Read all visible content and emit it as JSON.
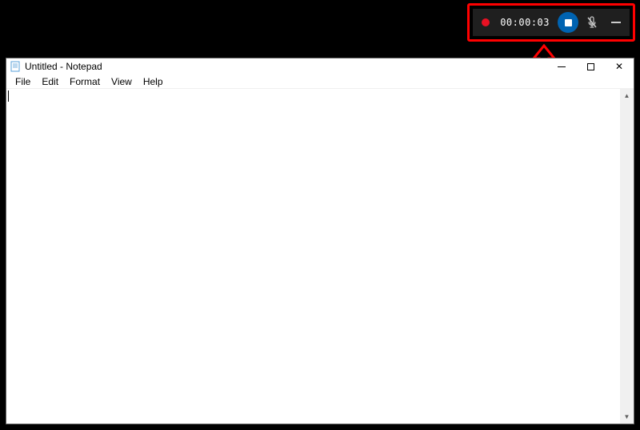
{
  "recording_toolbar": {
    "timer": "00:00:03",
    "status": "recording",
    "mic_state": "muted"
  },
  "notepad": {
    "title": "Untitled - Notepad",
    "menu": {
      "file": "File",
      "edit": "Edit",
      "format": "Format",
      "view": "View",
      "help": "Help"
    },
    "content": ""
  },
  "annotation": {
    "highlight_color": "#ff0000"
  }
}
